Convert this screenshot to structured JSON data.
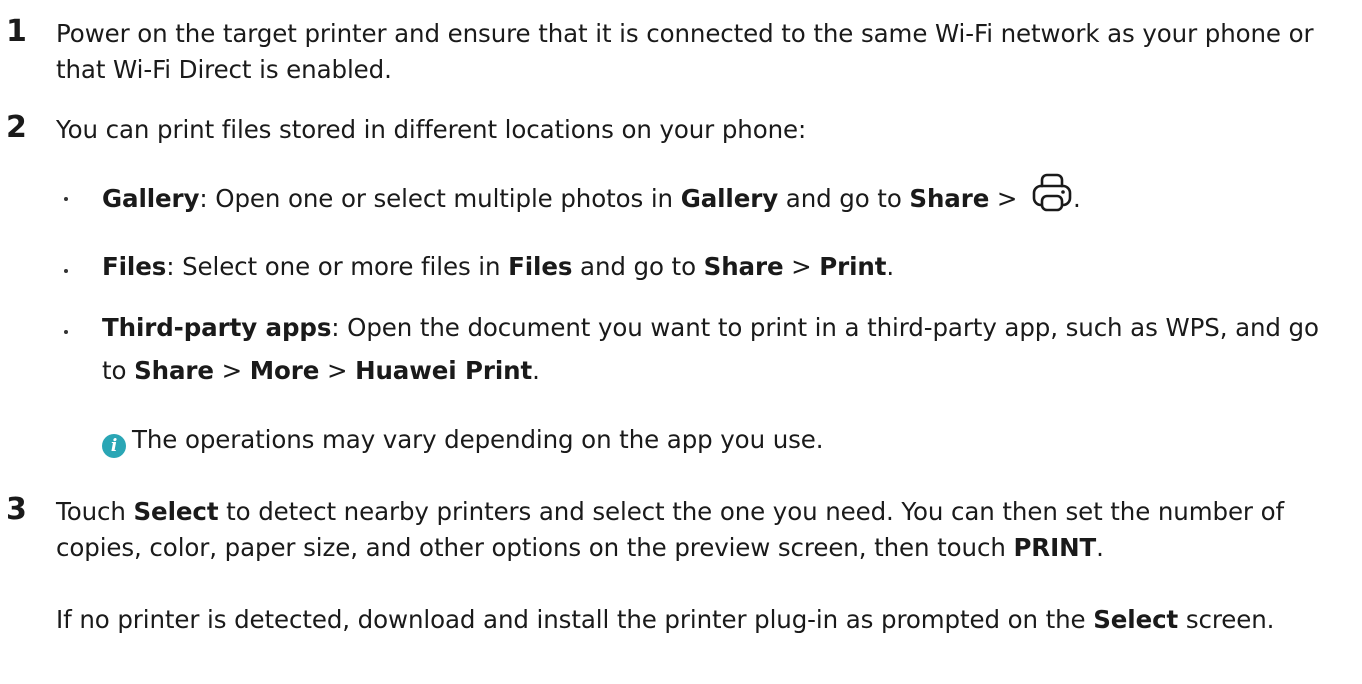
{
  "steps": [
    {
      "number": "1",
      "text": "Power on the target printer and ensure that it is connected to the same Wi-Fi network as your phone or that Wi-Fi Direct is enabled."
    },
    {
      "number": "2",
      "text": "You can print files stored in different locations on your phone:",
      "bullets": [
        {
          "label": "Gallery",
          "t1": ": Open one or select multiple photos in ",
          "b1": "Gallery",
          "t2": " and go to ",
          "b2": "Share",
          "t3": " > ",
          "icon": "printer-icon",
          "t4": "."
        },
        {
          "label": "Files",
          "t1": ": Select one or more files in ",
          "b1": "Files",
          "t2": " and go to ",
          "b2": "Share",
          "t3": " > ",
          "b3": "Print",
          "t4": "."
        },
        {
          "label": "Third-party apps",
          "t1": ": Open the document you want to print in a third-party app, such as WPS, and go to ",
          "b1": "Share",
          "t2": " > ",
          "b2": "More",
          "t3": " > ",
          "b3": "Huawei Print",
          "t4": "."
        }
      ],
      "note": {
        "icon": "info-icon",
        "icon_glyph": "i",
        "text": "The operations may vary depending on the app you use."
      }
    },
    {
      "number": "3",
      "t1": "Touch ",
      "b1": "Select",
      "t2": " to detect nearby printers and select the one you need. You can then set the number of copies, color, paper size, and other options on the preview screen, then touch ",
      "b2": "PRINT",
      "t3": ".",
      "para2": {
        "t1": "If no printer is detected, download and install the printer plug-in as prompted on the ",
        "b1": "Select",
        "t2": " screen."
      }
    }
  ],
  "colors": {
    "text": "#1a1a1a",
    "info_icon": "#2aa6b5"
  }
}
